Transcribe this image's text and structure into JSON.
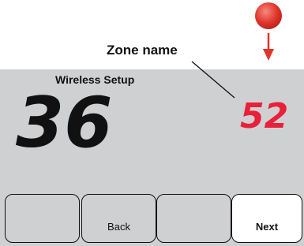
{
  "callout": {
    "label": "Zone name"
  },
  "screen": {
    "title": "Wireless Setup",
    "main_number": "36",
    "zone_number": "52"
  },
  "buttons": [
    {
      "label": ""
    },
    {
      "label": "Back"
    },
    {
      "label": ""
    },
    {
      "label": "Next"
    }
  ],
  "indicator": {
    "color": "#e0352b",
    "icon": "red-press-dot"
  },
  "colors": {
    "zone_digits": "#e8203a",
    "screen_bg": "#cfd0d2"
  }
}
